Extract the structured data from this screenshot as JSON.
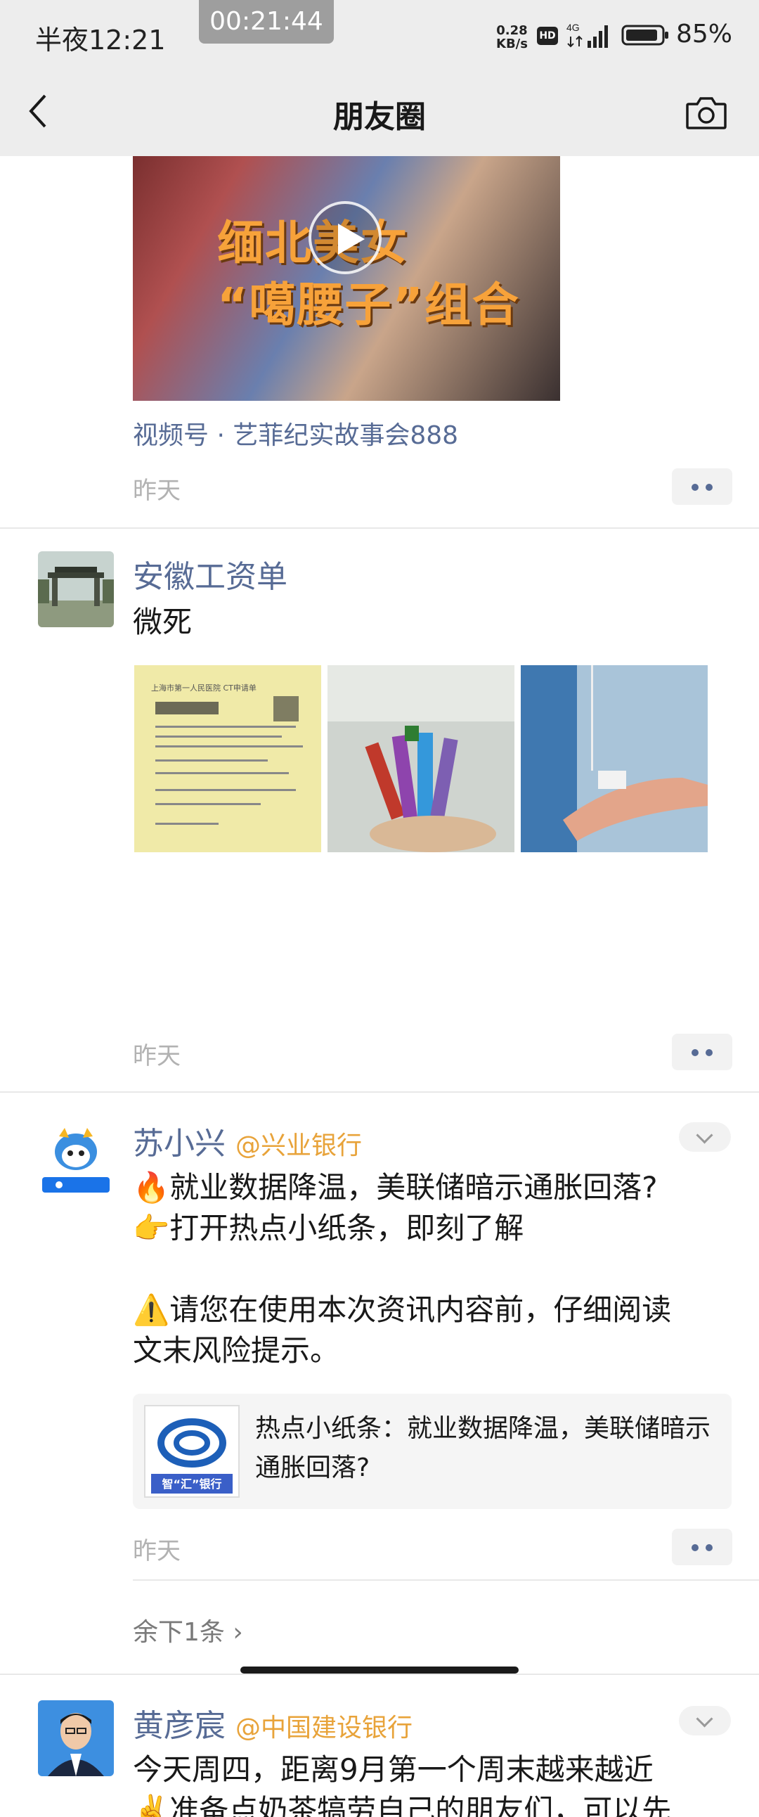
{
  "status_bar": {
    "time": "半夜12:21",
    "recording": "00:21:44",
    "net_speed_value": "0.28",
    "net_speed_unit": "KB/s",
    "hd_badge": "HD",
    "network": "4G",
    "battery": "85%"
  },
  "nav": {
    "title": "朋友圈",
    "back_icon": "back-arrow-icon",
    "camera_icon": "camera-icon"
  },
  "posts": [
    {
      "video_overlay_line1": "缅北美女",
      "video_overlay_line2": "“噶腰子”组合",
      "channel": "视频号 · 艺菲纪实故事会888",
      "time": "昨天"
    },
    {
      "author": "安徽工资单",
      "text": "微死",
      "photo_text": "上海市第一人民医院 CT申请单",
      "time": "昨天"
    },
    {
      "author": "苏小兴",
      "handle": "@兴业银行",
      "line1": "🔥就业数据降温，美联储暗示通胀回落?",
      "line2": "👉打开热点小纸条，即刻了解",
      "line3": "⚠️请您在使用本次资讯内容前，仔细阅读",
      "line4": "文末风险提示。",
      "card_title": "热点小纸条：就业数据降温，美联储暗示通胀回落?",
      "card_brand": "智“汇”银行",
      "time": "昨天",
      "remaining": "余下1条 ›"
    },
    {
      "author": "黄彦宸",
      "handle": "@中国建设银行",
      "line1": "今天周四，距离9月第一个周末越来越近",
      "line2": "✌️准备点奶茶犒劳自己的朋友们，可以先"
    }
  ],
  "colors": {
    "link": "#576b95",
    "handle": "#e8a33a",
    "bg_bar": "#ededed"
  }
}
